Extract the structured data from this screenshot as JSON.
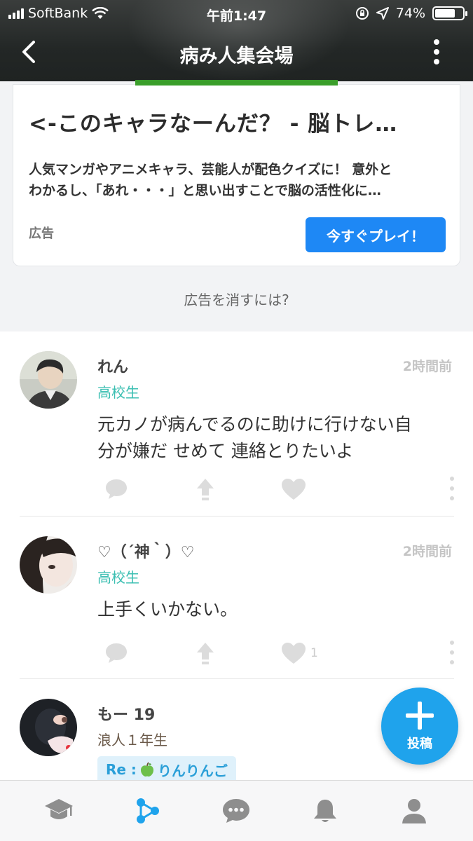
{
  "status_bar": {
    "carrier": "SoftBank",
    "time": "午前1:47",
    "battery": "74%",
    "battery_level": 0.74
  },
  "header": {
    "title": "病み人集会場",
    "back_icon": "chevron-left-icon",
    "menu_icon": "vertical-dots-icon"
  },
  "ad": {
    "title": "<-このキャラなーんだ？ - 脳トレ…",
    "description_line1": "人気マンガやアニメキャラ、芸能人が配色クイズに！ 意外と",
    "description_line2": "わかるし、「あれ・・・」と思い出すことで脳の活性化に…",
    "label": "広告",
    "button_label": "今すぐプレイ！",
    "remove_link": "広告を消すには?",
    "button_color": "#1e88f5"
  },
  "posts": [
    {
      "user": "れん",
      "time": "2時間前",
      "grade": "高校生",
      "text_line1": "元カノが病んでるのに助けに行けない自",
      "text_line2": "分が嫌だ せめて 連絡とりたいよ",
      "likes": ""
    },
    {
      "user": "♡（´神｀）♡",
      "time": "2時間前",
      "grade": "高校生",
      "text_line1": "上手くいかない。",
      "likes": "1"
    },
    {
      "user": "もー 19",
      "grade": "浪人１年生",
      "reply_prefix": "Re :",
      "reply_target": "りんりんご",
      "reply_emoji": "🍏"
    }
  ],
  "fab": {
    "label": "投稿",
    "color": "#1fa3ec"
  },
  "tabbar": {
    "items": [
      "graduation-cap-icon",
      "network-icon",
      "chat-bubble-icon",
      "bell-icon",
      "person-icon"
    ],
    "active_color": "#1fa3ec",
    "inactive_color": "#8e8e8e"
  }
}
